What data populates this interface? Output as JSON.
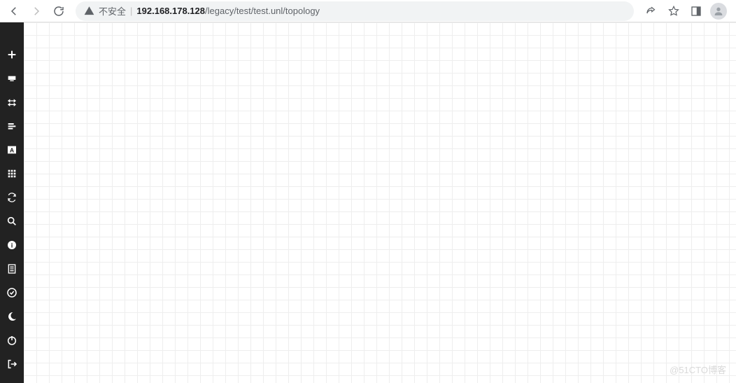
{
  "browser": {
    "security_label": "不安全",
    "url_host": "192.168.178.128",
    "url_path": "/legacy/test/test.unl/topology",
    "nav": {
      "back_icon": "back",
      "forward_icon": "forward",
      "reload_icon": "reload",
      "share_icon": "share",
      "star_icon": "bookmark-star",
      "panel_icon": "side-panel",
      "profile_icon": "profile"
    }
  },
  "sidebar": {
    "items": [
      {
        "name": "add-node",
        "icon": "plus"
      },
      {
        "name": "nodes",
        "icon": "server"
      },
      {
        "name": "networks",
        "icon": "arrows-h"
      },
      {
        "name": "startup-configs",
        "icon": "list-left"
      },
      {
        "name": "text-object",
        "icon": "text-a"
      },
      {
        "name": "grid-view",
        "icon": "grid"
      },
      {
        "name": "refresh",
        "icon": "refresh"
      },
      {
        "name": "zoom",
        "icon": "zoom"
      },
      {
        "name": "info",
        "icon": "info"
      },
      {
        "name": "logs",
        "icon": "doc-lines"
      },
      {
        "name": "status",
        "icon": "check-circle"
      },
      {
        "name": "dark-mode",
        "icon": "moon"
      },
      {
        "name": "power",
        "icon": "power"
      },
      {
        "name": "logout",
        "icon": "logout"
      }
    ]
  },
  "canvas": {
    "watermark": "@51CTO博客"
  }
}
